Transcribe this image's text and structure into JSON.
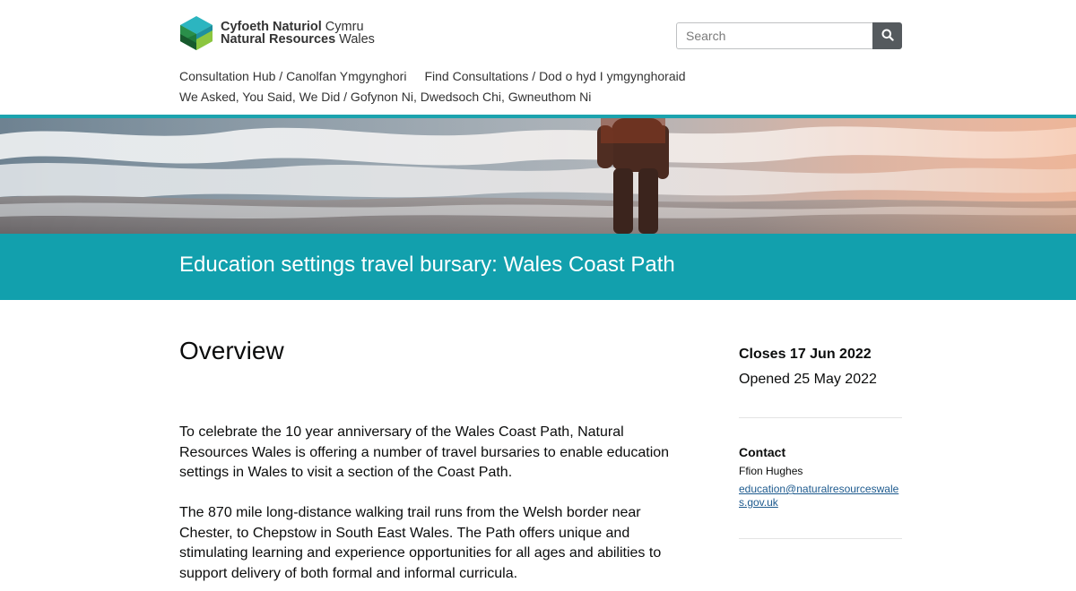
{
  "header": {
    "logo": {
      "welsh_name_bold": "Cyfoeth Naturiol",
      "welsh_name_light": " Cymru",
      "english_name_bold": "Natural Resources",
      "english_name_light": " Wales"
    },
    "search": {
      "placeholder": "Search",
      "button_icon": "search-icon"
    },
    "nav": {
      "items": [
        {
          "label": "Consultation Hub / Canolfan Ymgynghori"
        },
        {
          "label": "Find Consultations / Dod o hyd I ymgynghoraid"
        },
        {
          "label": "We Asked, You Said, We Did / Gofynon Ni, Dwedsoch Chi, Gwneuthom Ni"
        }
      ]
    }
  },
  "hero": {
    "image": "coastal-waves-person-photo"
  },
  "page_title": "Education settings travel bursary: Wales Coast Path",
  "main": {
    "heading": "Overview",
    "paragraphs": [
      "To celebrate the 10 year anniversary of the Wales Coast Path, Natural Resources Wales is offering a number of travel bursaries to enable education settings in Wales to visit a section of the Coast Path.",
      "The 870 mile long-distance walking trail runs from the Welsh border near Chester, to Chepstow in South East Wales. The Path offers unique and stimulating learning and experience opportunities for all ages and abilities to support delivery of both formal and informal curricula."
    ]
  },
  "sidebar": {
    "closes": "Closes 17 Jun 2022",
    "opened": "Opened 25 May 2022",
    "contact": {
      "heading": "Contact",
      "name": "Ffion Hughes",
      "email": "education@naturalresourceswales.gov.uk"
    }
  },
  "colors": {
    "teal": "#12a0ad",
    "teal_rule": "#1ba3ae",
    "link": "#1d5a8e",
    "search_button": "#555a5e"
  }
}
